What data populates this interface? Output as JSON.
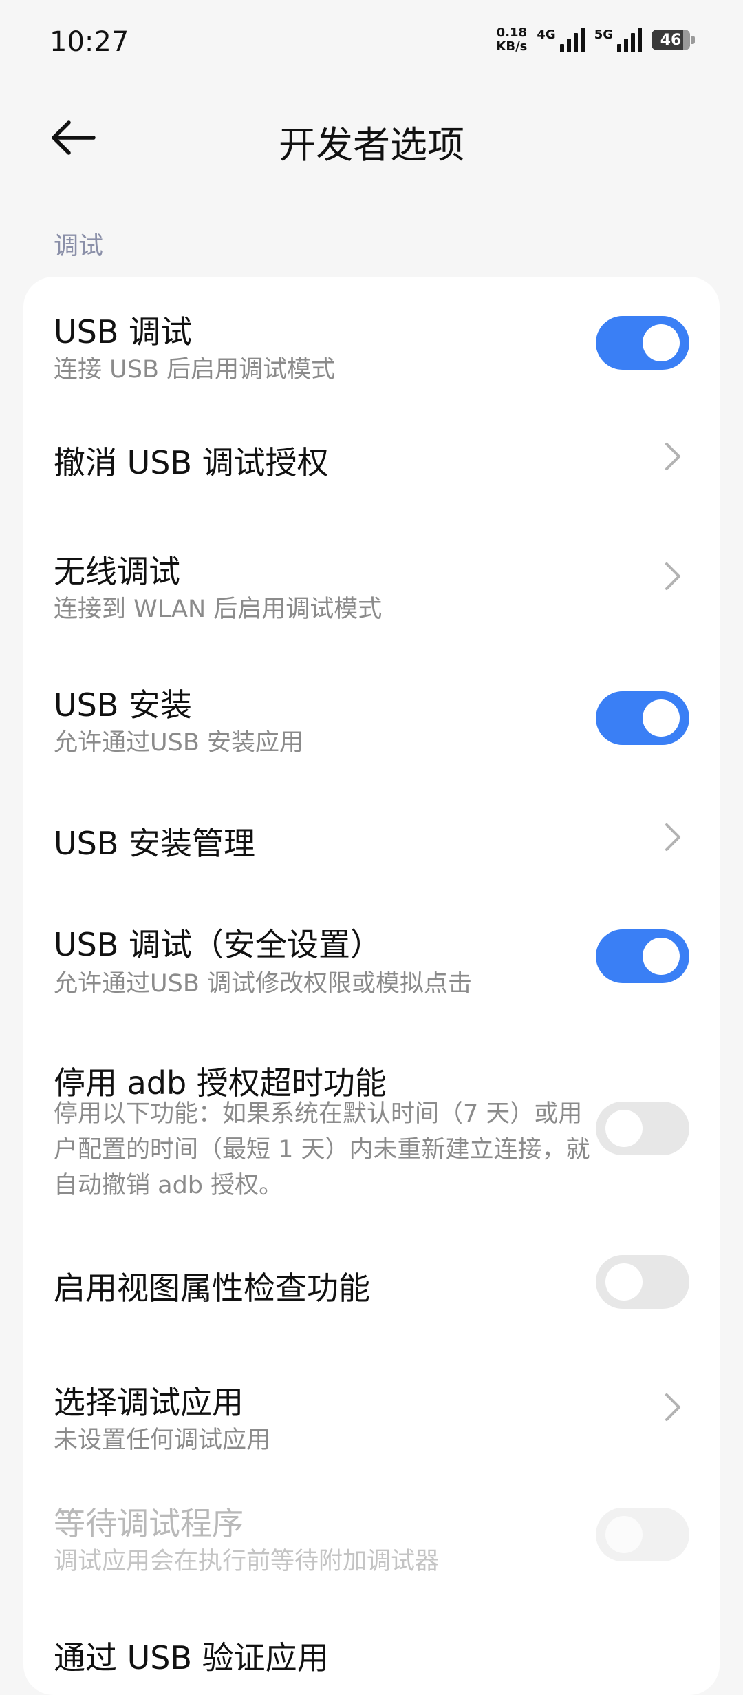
{
  "status_bar": {
    "time": "10:27",
    "net_speed_value": "0.18",
    "net_speed_unit": "KB/s",
    "signal1_label": "4G",
    "signal2_label": "5G",
    "battery_percent": "46"
  },
  "header": {
    "title": "开发者选项",
    "back_icon": "arrow-left-icon"
  },
  "section": {
    "label": "调试"
  },
  "rows": [
    {
      "title": "USB 调试",
      "subtitle": "连接 USB 后启用调试模式",
      "control": "toggle",
      "state": "on"
    },
    {
      "title": "撤消 USB 调试授权",
      "control": "chevron"
    },
    {
      "title": "无线调试",
      "subtitle": "连接到 WLAN 后启用调试模式",
      "control": "chevron"
    },
    {
      "title": "USB 安装",
      "subtitle": "允许通过USB 安装应用",
      "control": "toggle",
      "state": "on"
    },
    {
      "title": "USB 安装管理",
      "control": "chevron"
    },
    {
      "title": "USB 调试（安全设置）",
      "subtitle": "允许通过USB 调试修改权限或模拟点击",
      "control": "toggle",
      "state": "on"
    },
    {
      "title": "停用 adb 授权超时功能",
      "subtitle": "停用以下功能：如果系统在默认时间（7 天）或用户配置的时间（最短 1 天）内未重新建立连接，就自动撤销 adb 授权。",
      "control": "toggle",
      "state": "off"
    },
    {
      "title": "启用视图属性检查功能",
      "control": "toggle",
      "state": "off"
    },
    {
      "title": "选择调试应用",
      "subtitle": "未设置任何调试应用",
      "control": "chevron"
    },
    {
      "title": "等待调试程序",
      "subtitle": "调试应用会在执行前等待附加调试器",
      "control": "toggle",
      "state": "disabled"
    },
    {
      "title": "通过 USB 验证应用"
    }
  ],
  "colors": {
    "accent": "#3a7ff5",
    "background": "#f6f6f6",
    "card": "#ffffff",
    "section_label": "#8a8fa8"
  }
}
